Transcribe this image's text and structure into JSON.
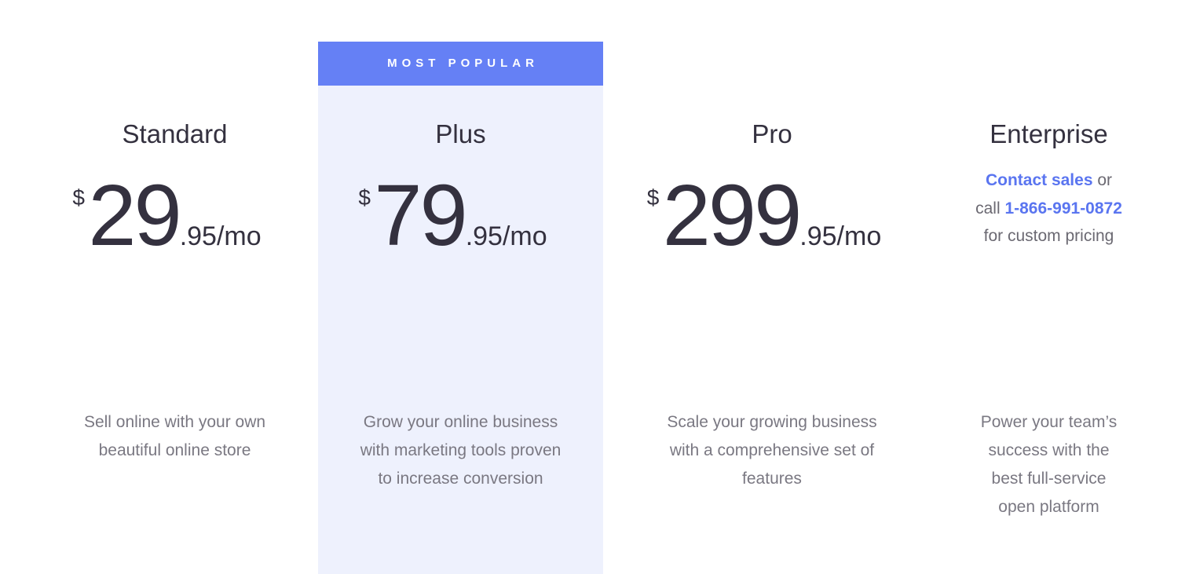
{
  "badge": {
    "label": "MOST POPULAR"
  },
  "plans": [
    {
      "name": "Standard",
      "price": {
        "currency": "$",
        "main": "29",
        "cents": ".95/mo"
      },
      "description": "Sell online with your own beautiful online store"
    },
    {
      "name": "Plus",
      "price": {
        "currency": "$",
        "main": "79",
        "cents": ".95/mo"
      },
      "description": "Grow your online business with marketing tools proven to increase conversion"
    },
    {
      "name": "Pro",
      "price": {
        "currency": "$",
        "main": "299",
        "cents": ".95/mo"
      },
      "description": "Scale your growing business with a comprehensive set of features"
    },
    {
      "name": "Enterprise",
      "contact": {
        "link_label": "Contact sales",
        "text_or_call": " or call ",
        "phone": "1-866-991-0872",
        "text_after": " for custom pricing"
      },
      "description": "Power your team’s success with the best full-service open platform"
    }
  ],
  "colors": {
    "badge_bg": "#6580f5",
    "highlight_bg": "#eef1fd",
    "link": "#5a75f0",
    "heading": "#34313f",
    "body_text": "#7a7882"
  }
}
